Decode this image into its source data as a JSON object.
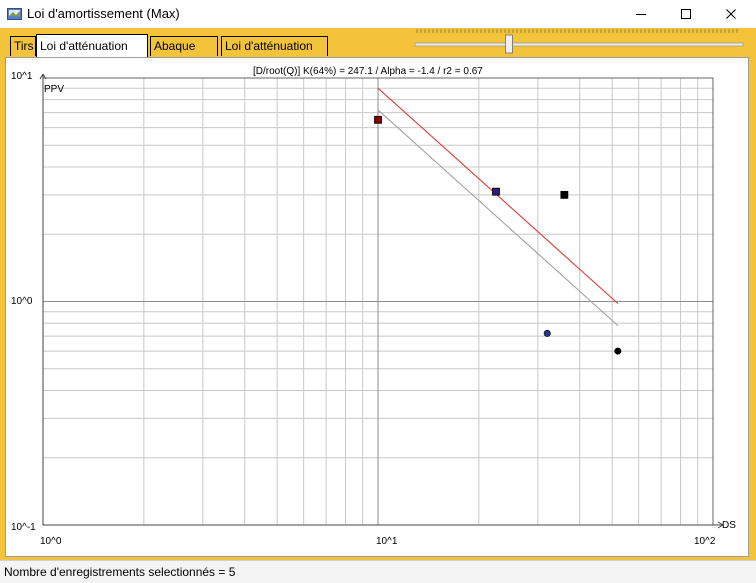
{
  "window": {
    "title": "Loi d'amortissement (Max)"
  },
  "tabs": [
    {
      "label": "Tirs",
      "active": false
    },
    {
      "label": "Loi d'atténuation (Sol)",
      "active": true
    },
    {
      "label": "Abaque (Sol)",
      "active": false
    },
    {
      "label": "Loi d'atténuation (Air)",
      "active": false
    }
  ],
  "slider": {
    "value_fraction": 0.29
  },
  "status": {
    "text": "Nombre d'enregistrements selectionnés = 5"
  },
  "colors": {
    "frame": "#f3c33a",
    "regression_line": "#e23a3a",
    "reference_line": "#a0a0a0"
  },
  "chart_data": {
    "type": "scatter",
    "title": "[D/root(Q)]  K(64%) = 247.1 / Alpha = -1.4 / r2 = 0.67",
    "xlabel": "DS",
    "ylabel": "PPV",
    "xscale": "log",
    "yscale": "log",
    "xlim": [
      1,
      100
    ],
    "ylim": [
      0.1,
      10
    ],
    "x_tick_labels": [
      "10^0",
      "10^1",
      "10^2"
    ],
    "y_tick_labels": [
      "10^1",
      "10^0",
      "10^-1"
    ],
    "grid": true,
    "points": [
      {
        "x": 10.0,
        "y": 6.5,
        "marker": "square",
        "color": "#8b0000"
      },
      {
        "x": 22.5,
        "y": 3.1,
        "marker": "square",
        "color": "#2a1e7a"
      },
      {
        "x": 36.0,
        "y": 3.0,
        "marker": "square",
        "color": "#000000"
      },
      {
        "x": 32.0,
        "y": 0.72,
        "marker": "circle",
        "color": "#1f3a8a"
      },
      {
        "x": 52.0,
        "y": 0.6,
        "marker": "circle",
        "color": "#000000"
      }
    ],
    "lines": [
      {
        "name": "",
        "color": "#e23a3a",
        "x": [
          10.0,
          52.0
        ],
        "y": [
          9.0,
          0.98
        ]
      },
      {
        "name": "",
        "color": "#a0a0a0",
        "x": [
          10.0,
          52.0
        ],
        "y": [
          7.2,
          0.78
        ]
      }
    ]
  }
}
